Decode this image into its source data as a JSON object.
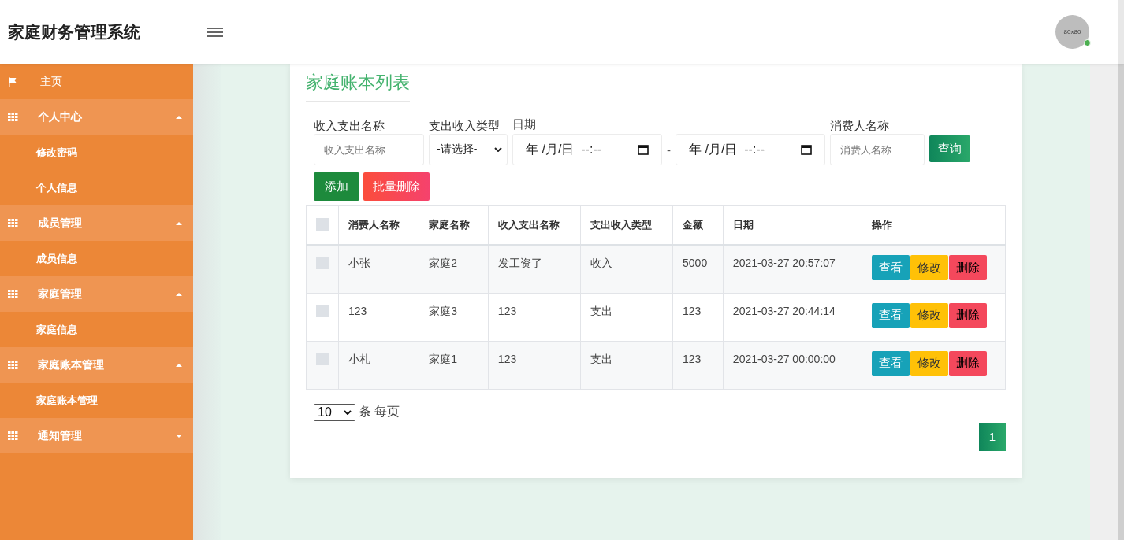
{
  "header": {
    "title": "家庭财务管理系统",
    "avatar_text": "80x80"
  },
  "sidebar": {
    "items": [
      {
        "label": "主页",
        "kind": "link"
      },
      {
        "label": "个人中心",
        "kind": "group",
        "expanded": true,
        "children": [
          {
            "label": "修改密码"
          },
          {
            "label": "个人信息"
          }
        ]
      },
      {
        "label": "成员管理",
        "kind": "group",
        "expanded": true,
        "children": [
          {
            "label": "成员信息"
          }
        ]
      },
      {
        "label": "家庭管理",
        "kind": "group",
        "expanded": true,
        "children": [
          {
            "label": "家庭信息"
          }
        ]
      },
      {
        "label": "家庭账本管理",
        "kind": "group",
        "expanded": true,
        "children": [
          {
            "label": "家庭账本管理"
          }
        ]
      },
      {
        "label": "通知管理",
        "kind": "group",
        "expanded": false
      }
    ]
  },
  "panel": {
    "title": "家庭账本列表",
    "filters": [
      {
        "kind": "text",
        "label": "收入支出名称",
        "placeholder": "收入支出名称"
      },
      {
        "kind": "select",
        "label": "支出收入类型",
        "value": "-请选择-"
      },
      {
        "kind": "daterange",
        "label": "日期",
        "from": "年 /月/日  --:--",
        "separator": "-",
        "to": "年 /月/日  --:--"
      },
      {
        "kind": "text",
        "label": "消费人名称",
        "placeholder": "消费人名称"
      }
    ],
    "search_button": "查询",
    "actions": [
      {
        "label": "添加",
        "kind": "add"
      },
      {
        "label": "批量删除",
        "kind": "delete"
      }
    ],
    "table": {
      "all_checked": false,
      "columns": [
        "消费人名称",
        "家庭名称",
        "收入支出名称",
        "支出收入类型",
        "金额",
        "日期",
        "操作"
      ],
      "rows": [
        {
          "checked": false,
          "cells": [
            "小张",
            "家庭2",
            "发工资了",
            "收入",
            "5000",
            "2021-03-27 20:57:07"
          ],
          "actions": [
            {
              "label": "查看",
              "kind": "view"
            },
            {
              "label": "修改",
              "kind": "edit"
            },
            {
              "label": "删除",
              "kind": "delete"
            }
          ]
        },
        {
          "checked": false,
          "cells": [
            "123",
            "家庭3",
            "123",
            "支出",
            "123",
            "2021-03-27 20:44:14"
          ],
          "actions": [
            {
              "label": "查看",
              "kind": "view"
            },
            {
              "label": "修改",
              "kind": "edit"
            },
            {
              "label": "删除",
              "kind": "delete"
            }
          ]
        },
        {
          "checked": false,
          "cells": [
            "小札",
            "家庭1",
            "123",
            "支出",
            "123",
            "2021-03-27 00:00:00"
          ],
          "actions": [
            {
              "label": "查看",
              "kind": "view"
            },
            {
              "label": "修改",
              "kind": "edit"
            },
            {
              "label": "删除",
              "kind": "delete"
            }
          ]
        }
      ]
    },
    "page_size": "10",
    "page_size_suffix": "条 每页",
    "pages": [
      {
        "label": "1",
        "selected": true
      }
    ]
  }
}
